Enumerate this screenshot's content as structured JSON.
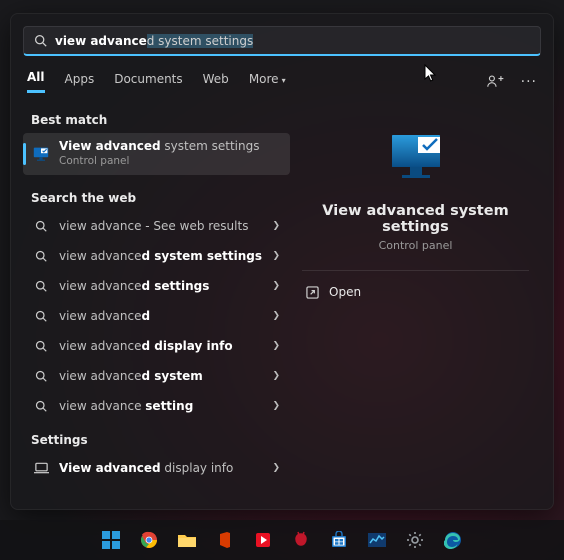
{
  "search": {
    "typed": "view advance",
    "suggestion_tail": "d system settings"
  },
  "tabs": {
    "items": [
      "All",
      "Apps",
      "Documents",
      "Web",
      "More"
    ],
    "active_index": 0
  },
  "sections": {
    "best_match": "Best match",
    "search_web": "Search the web",
    "settings": "Settings"
  },
  "best_match": {
    "title_bold": "View advanced",
    "title_light": " system settings",
    "subtitle": "Control panel"
  },
  "web_results": [
    {
      "prefix_light": "view advance",
      "bold": "",
      "suffix_light": " - See web results"
    },
    {
      "prefix_light": "view advance",
      "bold": "d system settings",
      "suffix_light": ""
    },
    {
      "prefix_light": "view advance",
      "bold": "d settings",
      "suffix_light": ""
    },
    {
      "prefix_light": "view advance",
      "bold": "d",
      "suffix_light": ""
    },
    {
      "prefix_light": "view advance",
      "bold": "d display info",
      "suffix_light": ""
    },
    {
      "prefix_light": "view advance",
      "bold": "d system",
      "suffix_light": ""
    },
    {
      "prefix_light": "view advance ",
      "bold": "setting",
      "suffix_light": ""
    }
  ],
  "settings_results": [
    {
      "bold": "View advanced",
      "light": " display info"
    }
  ],
  "preview": {
    "title": "View advanced system settings",
    "subtitle": "Control panel",
    "open": "Open"
  },
  "colors": {
    "accent": "#4cc2ff",
    "monitor_blue": "#0f6cbd"
  }
}
